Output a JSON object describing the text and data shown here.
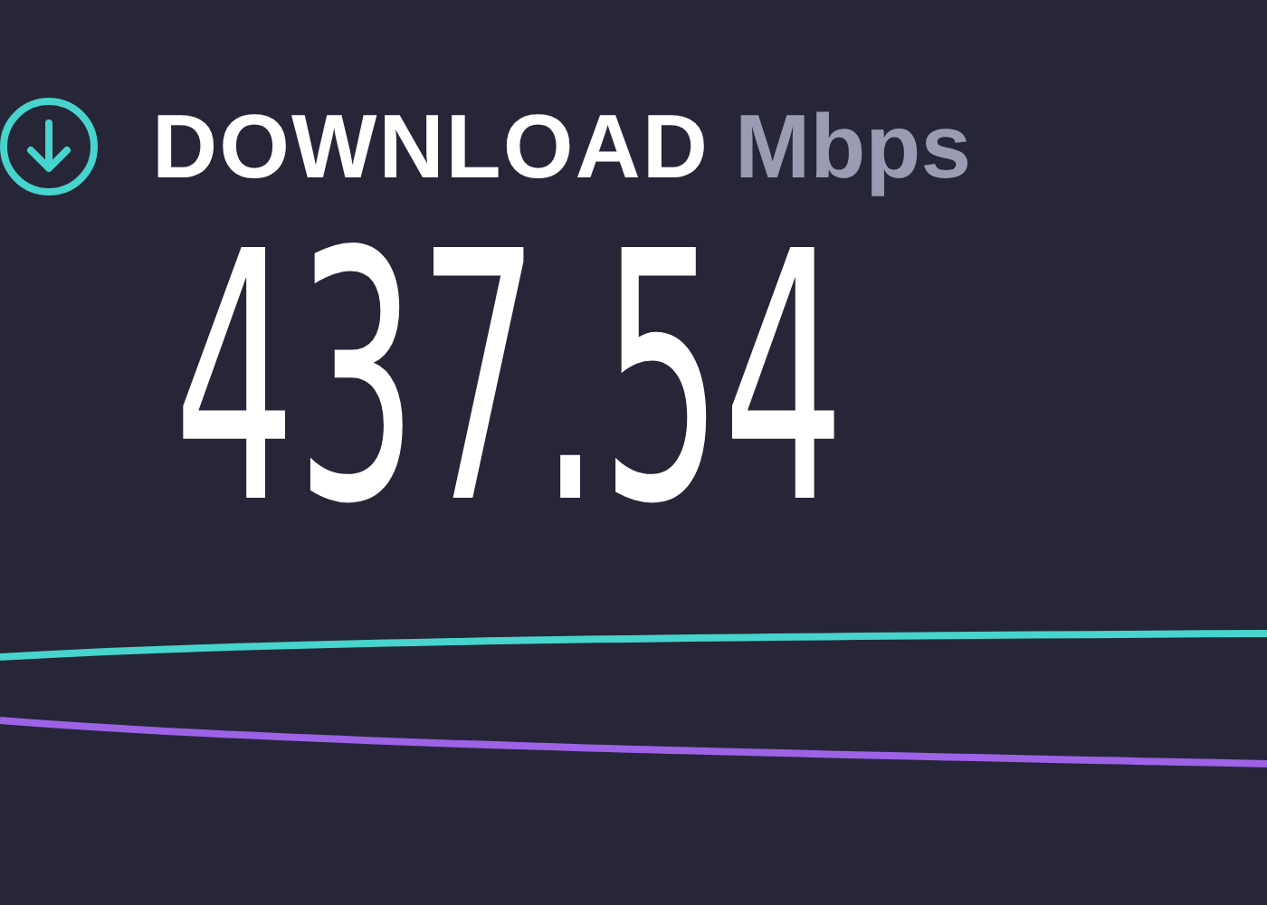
{
  "test": {
    "label": "DOWNLOAD",
    "unit": "Mbps",
    "value": "437.54"
  }
}
